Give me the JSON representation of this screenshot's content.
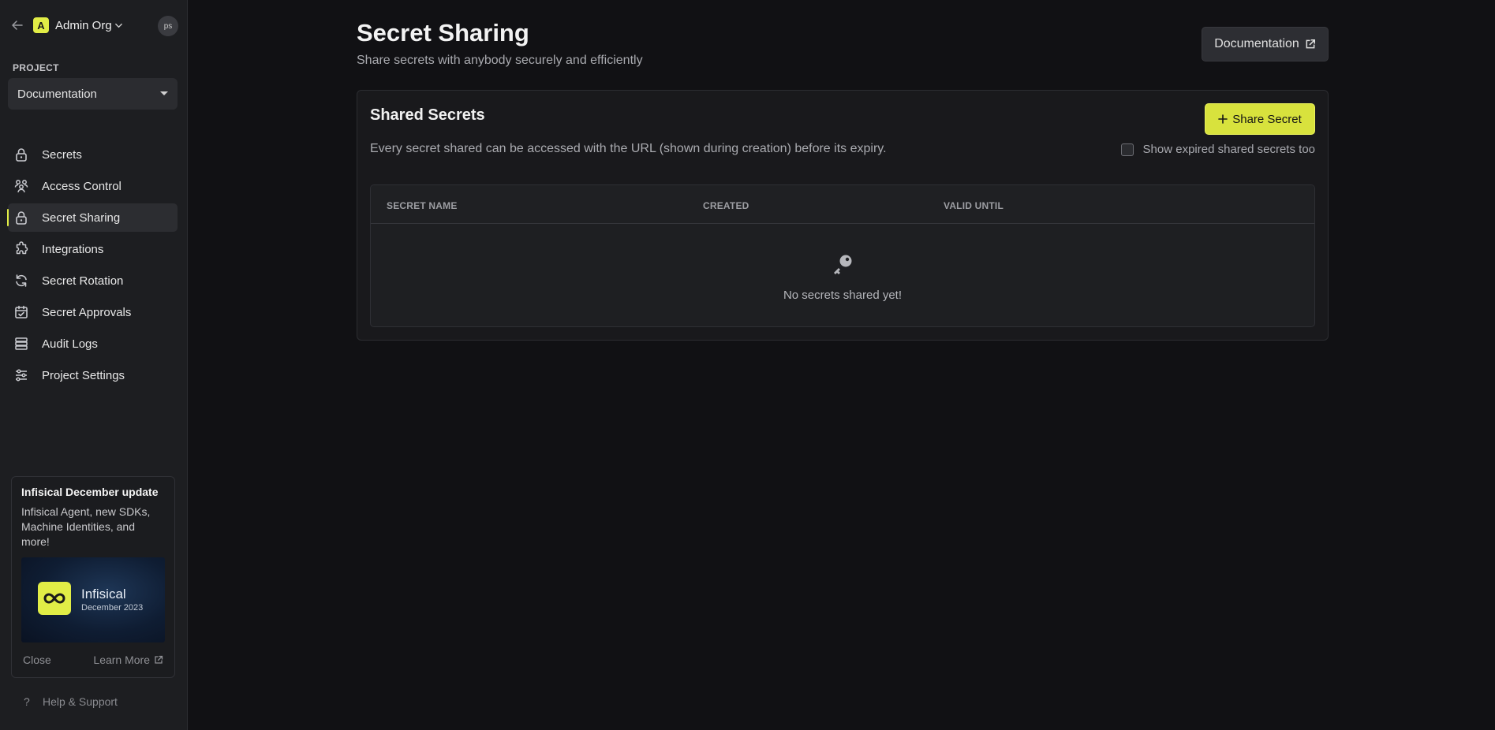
{
  "sidebar": {
    "org_logo_letter": "A",
    "org_name": "Admin Org",
    "avatar_initials": "ps",
    "project_label": "PROJECT",
    "project_name": "Documentation",
    "items": [
      {
        "label": "Secrets",
        "icon": "lock-icon",
        "active": false
      },
      {
        "label": "Access Control",
        "icon": "users-icon",
        "active": false
      },
      {
        "label": "Secret Sharing",
        "icon": "lock-icon",
        "active": true
      },
      {
        "label": "Integrations",
        "icon": "puzzle-icon",
        "active": false
      },
      {
        "label": "Secret Rotation",
        "icon": "rotate-icon",
        "active": false
      },
      {
        "label": "Secret Approvals",
        "icon": "calendar-check-icon",
        "active": false
      },
      {
        "label": "Audit Logs",
        "icon": "server-icon",
        "active": false
      },
      {
        "label": "Project Settings",
        "icon": "sliders-icon",
        "active": false
      }
    ],
    "promo": {
      "title": "Infisical December update",
      "text": "Infisical Agent, new SDKs, Machine Identities, and more!",
      "image_brand": "Infisical",
      "image_sub": "December 2023",
      "close_label": "Close",
      "learn_more_label": "Learn More"
    },
    "help_label": "Help & Support"
  },
  "header": {
    "title": "Secret Sharing",
    "subtitle": "Share secrets with anybody securely and efficiently",
    "doc_button_label": "Documentation"
  },
  "card": {
    "title": "Shared Secrets",
    "description": "Every secret shared can be accessed with the URL (shown during creation) before its expiry.",
    "share_button_label": "Share Secret",
    "show_expired_label": "Show expired shared secrets too",
    "show_expired_checked": false,
    "table": {
      "columns": [
        "SECRET NAME",
        "CREATED",
        "VALID UNTIL"
      ],
      "rows": [],
      "empty_text": "No secrets shared yet!"
    }
  },
  "colors": {
    "accent": "#e1ed46",
    "background": "#111114",
    "sidebar": "#1d1e21"
  }
}
